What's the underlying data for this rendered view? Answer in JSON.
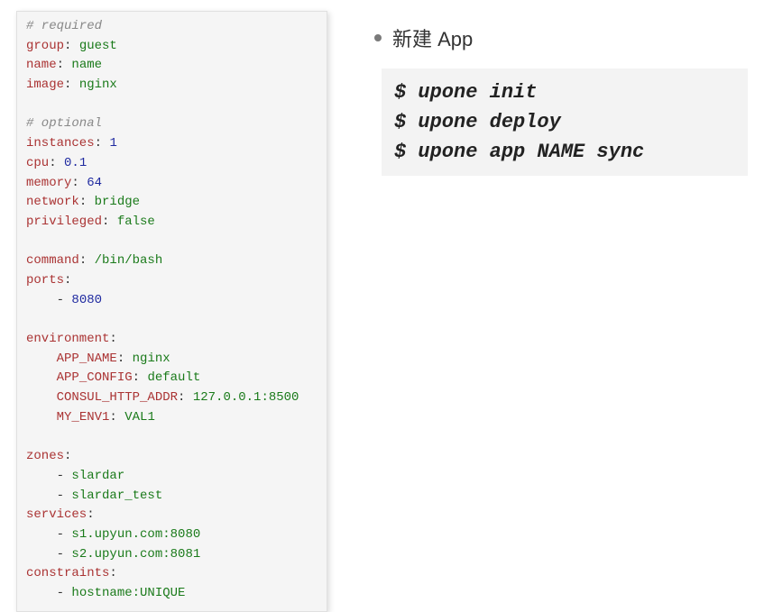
{
  "yaml": {
    "comment_required": "# required",
    "group_k": "group",
    "group_v": "guest",
    "name_k": "name",
    "name_v": "name",
    "image_k": "image",
    "image_v": "nginx",
    "comment_optional": "# optional",
    "instances_k": "instances",
    "instances_v": "1",
    "cpu_k": "cpu",
    "cpu_v": "0.1",
    "memory_k": "memory",
    "memory_v": "64",
    "network_k": "network",
    "network_v": "bridge",
    "privileged_k": "privileged",
    "privileged_v": "false",
    "command_k": "command",
    "command_v": "/bin/bash",
    "ports_k": "ports",
    "ports_v0": "8080",
    "environment_k": "environment",
    "env0_k": "APP_NAME",
    "env0_v": "nginx",
    "env1_k": "APP_CONFIG",
    "env1_v": "default",
    "env2_k": "CONSUL_HTTP_ADDR",
    "env2_v": "127.0.0.1:8500",
    "env3_k": "MY_ENV1",
    "env3_v": "VAL1",
    "zones_k": "zones",
    "zones_v0": "slardar",
    "zones_v1": "slardar_test",
    "services_k": "services",
    "services_v0": "s1.upyun.com:8080",
    "services_v1": "s2.upyun.com:8081",
    "constraints_k": "constraints",
    "constraints_v0": "hostname:UNIQUE"
  },
  "right": {
    "bullet": "新建 App",
    "cmd1": "$ upone init",
    "cmd2": "$ upone deploy",
    "cmd3": "$ upone app NAME sync"
  }
}
